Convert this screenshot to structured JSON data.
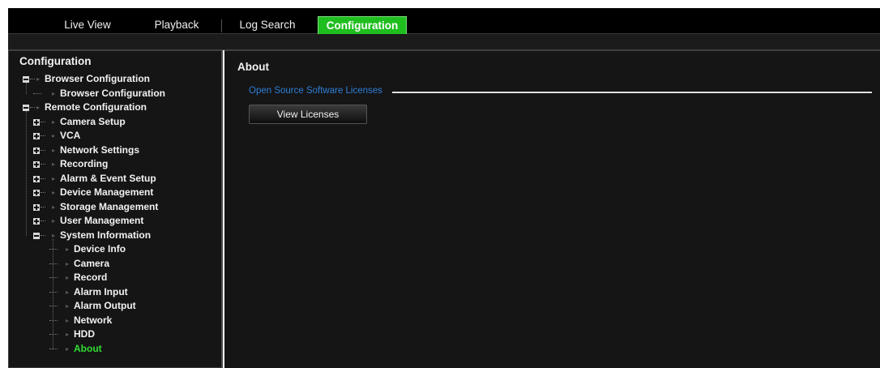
{
  "nav": {
    "tabs": [
      {
        "label": "Live View"
      },
      {
        "label": "Playback"
      },
      {
        "label": "Log Search"
      },
      {
        "label": "Configuration",
        "active": true
      }
    ]
  },
  "sidebar": {
    "title": "Configuration",
    "tree": [
      {
        "label": "Browser Configuration",
        "level": 0,
        "expander": "minus"
      },
      {
        "label": "Browser Configuration",
        "level": 1,
        "expander": "none"
      },
      {
        "label": "Remote Configuration",
        "level": 0,
        "expander": "minus"
      },
      {
        "label": "Camera Setup",
        "level": 1,
        "expander": "plus"
      },
      {
        "label": "VCA",
        "level": 1,
        "expander": "plus"
      },
      {
        "label": "Network Settings",
        "level": 1,
        "expander": "plus"
      },
      {
        "label": "Recording",
        "level": 1,
        "expander": "plus"
      },
      {
        "label": "Alarm & Event Setup",
        "level": 1,
        "expander": "plus"
      },
      {
        "label": "Device Management",
        "level": 1,
        "expander": "plus"
      },
      {
        "label": "Storage Management",
        "level": 1,
        "expander": "plus"
      },
      {
        "label": "User Management",
        "level": 1,
        "expander": "plus"
      },
      {
        "label": "System Information",
        "level": 1,
        "expander": "minus"
      },
      {
        "label": "Device Info",
        "level": 2,
        "expander": "none"
      },
      {
        "label": "Camera",
        "level": 2,
        "expander": "none"
      },
      {
        "label": "Record",
        "level": 2,
        "expander": "none"
      },
      {
        "label": "Alarm Input",
        "level": 2,
        "expander": "none"
      },
      {
        "label": "Alarm Output",
        "level": 2,
        "expander": "none"
      },
      {
        "label": "Network",
        "level": 2,
        "expander": "none"
      },
      {
        "label": "HDD",
        "level": 2,
        "expander": "none"
      },
      {
        "label": "About",
        "level": 2,
        "expander": "none",
        "selected": true
      }
    ]
  },
  "main": {
    "title": "About",
    "section_label": "Open Source Software Licenses",
    "view_licenses_label": "View Licenses"
  },
  "colors": {
    "accent_green": "#1fbe1f",
    "selected_text": "#33dd33",
    "section_blue": "#2e7fd6"
  }
}
